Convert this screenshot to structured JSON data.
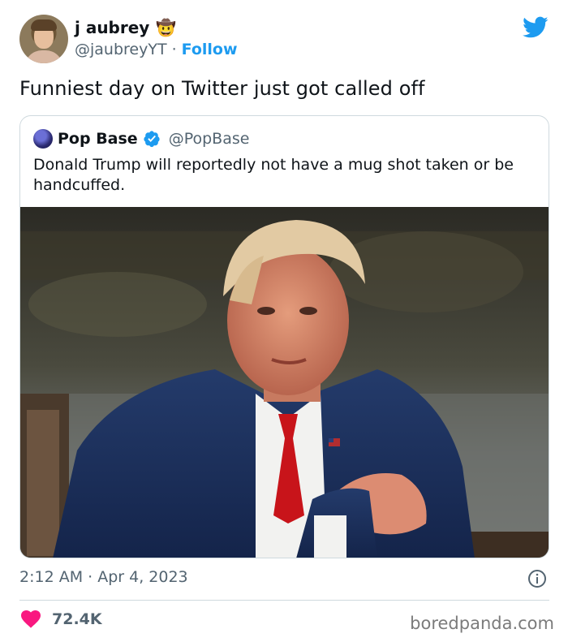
{
  "author": {
    "name": "j aubrey",
    "name_emoji": "🤠",
    "handle": "@jaubreyYT",
    "separator": "·",
    "follow_label": "Follow"
  },
  "tweet": {
    "text": "Funniest day on Twitter just got called off",
    "timestamp": "2:12 AM · Apr 4, 2023",
    "likes": "72.4K"
  },
  "quoted_tweet": {
    "name": "Pop Base",
    "handle": "@PopBase",
    "text": "Donald Trump will reportedly not have a mug shot taken or be handcuffed."
  },
  "watermark": "boredpanda.com",
  "icons": {
    "platform_logo": "twitter-bird-icon",
    "verified": "verified-badge-icon",
    "info": "info-icon",
    "like": "heart-icon"
  },
  "colors": {
    "accent": "#1d9bf0",
    "like": "#f91880",
    "secondary_text": "#536471",
    "text": "#0f1419",
    "border": "#cfd9de"
  }
}
